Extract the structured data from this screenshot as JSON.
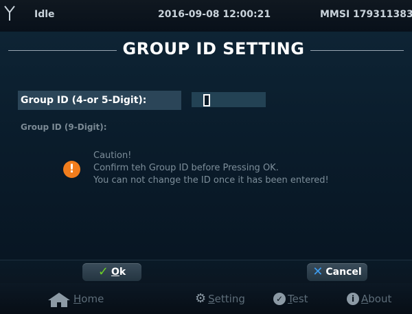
{
  "status_bar": {
    "state": "Idle",
    "datetime": "2016-09-08 12:00:21",
    "mmsi": "MMSI 179311383"
  },
  "title": "GROUP ID SETTING",
  "fields": {
    "group_id_short_label": "Group ID (4-or 5-Digit):",
    "group_id_short_value": "",
    "group_id_long_label": "Group ID (9-Digit):"
  },
  "caution": {
    "icon": "exclamation-icon",
    "line1": "Caution!",
    "line2": "Confirm teh Group ID before Pressing OK.",
    "line3": "You can not change the ID once it has been entered!"
  },
  "softkeys": {
    "ok_icon": "check-icon",
    "ok_label": "Ok",
    "cancel_icon": "x-icon",
    "cancel_label": "Cancel"
  },
  "nav": {
    "home": "Home",
    "setting": "Setting",
    "test": "Test",
    "about": "About"
  },
  "colors": {
    "caution_accent": "#f17d1d",
    "ok_accent": "#6cd126",
    "cancel_accent": "#3e9df0",
    "background": "#0f2637"
  }
}
